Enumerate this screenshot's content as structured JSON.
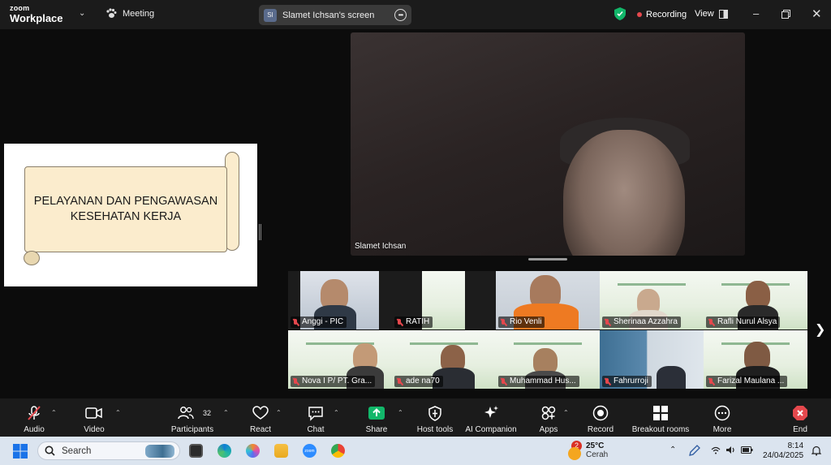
{
  "titlebar": {
    "logo_line1": "zoom",
    "logo_line2": "Workplace",
    "meeting_label": "Meeting",
    "screen_initials": "SI",
    "screen_label": "Slamet  Ichsan's screen",
    "recording_label": "Recording",
    "view_label": "View"
  },
  "slide": {
    "line1": "PELAYANAN DAN PENGAWASAN",
    "line2": "KESEHATAN KERJA"
  },
  "speaker": {
    "name": "Slamet  Ichsan"
  },
  "participants": [
    {
      "name": "Anggi - PIC",
      "muted": true
    },
    {
      "name": "RATIH",
      "muted": true
    },
    {
      "name": "Rio Venli",
      "muted": true
    },
    {
      "name": "Sherinaa Azzahra",
      "muted": true
    },
    {
      "name": "Rafli Nurul Alsya",
      "muted": true
    },
    {
      "name": "Nova I P/ PT. Gra...",
      "muted": true
    },
    {
      "name": "ade na70",
      "muted": true
    },
    {
      "name": "Muhammad Hus...",
      "muted": true
    },
    {
      "name": "Fahrurroji",
      "muted": true
    },
    {
      "name": "Farizal Maulana ...",
      "muted": true
    }
  ],
  "toolbar": {
    "audio": "Audio",
    "video": "Video",
    "participants": "Participants",
    "participants_count": "32",
    "react": "React",
    "chat": "Chat",
    "share": "Share",
    "host_tools": "Host tools",
    "ai_companion": "AI Companion",
    "apps": "Apps",
    "record": "Record",
    "breakout_rooms": "Breakout rooms",
    "more": "More",
    "end": "End"
  },
  "taskbar": {
    "search_placeholder": "Search",
    "weather_badge": "2",
    "weather_temp": "25°C",
    "weather_desc": "Cerah",
    "time": "8:14",
    "date": "24/04/2025"
  },
  "colors": {
    "accent_green": "#12b76a",
    "recording_red": "#e5484d",
    "end_red": "#e5484d",
    "toolbar_bg": "#1b1b1b"
  }
}
